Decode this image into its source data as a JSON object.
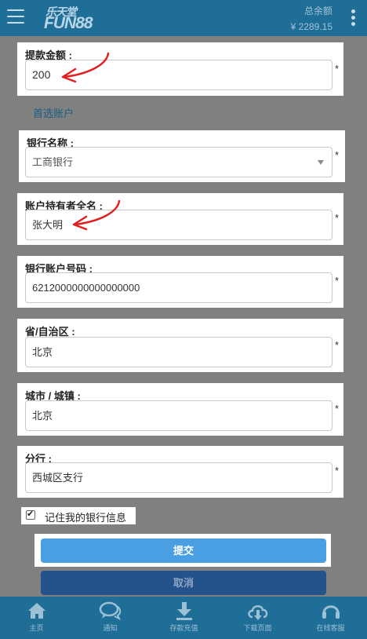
{
  "header": {
    "logo_cn": "乐天堂",
    "logo_en": "FUN88",
    "balance_label": "总余额",
    "balance_amount": "¥ 2289.15"
  },
  "form": {
    "amount": {
      "label": "提款金额 :",
      "value": "200",
      "required": "*"
    },
    "preferred_account_link": "首选账户",
    "bank_name": {
      "label": "银行名称 :",
      "value": "工商银行",
      "required": "*"
    },
    "holder_name": {
      "label": "账户持有者全名 :",
      "value": "张大明",
      "required": "*"
    },
    "account_number": {
      "label": "银行账户号码 :",
      "value": "6212000000000000000",
      "required": "*"
    },
    "province": {
      "label": "省/自治区 :",
      "value": "北京",
      "required": "*"
    },
    "city": {
      "label": "城市 / 城镇 :",
      "value": "北京",
      "required": "*"
    },
    "branch": {
      "label": "分行 :",
      "value": "西城区支行",
      "required": "*"
    },
    "remember_label": "记住我的银行信息",
    "remember_checked": true,
    "submit_label": "提交",
    "cancel_label": "取消"
  },
  "footer": {
    "items": [
      {
        "label": "主页",
        "icon": "home-icon"
      },
      {
        "label": "通知",
        "icon": "chat-icon"
      },
      {
        "label": "存款充值",
        "icon": "download-icon"
      },
      {
        "label": "下载页面",
        "icon": "cloud-download-icon"
      },
      {
        "label": "在线客服",
        "icon": "headset-icon"
      }
    ]
  },
  "colors": {
    "header_bg": "#1f6e98",
    "page_bg": "#808080",
    "submit_bg": "#4a9fe3",
    "cancel_bg": "#23538a",
    "link": "#1a5d86",
    "annotation_arrow": "#e02020"
  }
}
